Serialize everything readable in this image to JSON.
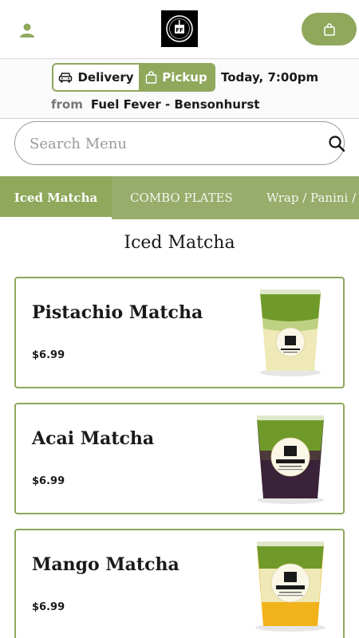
{
  "header": {
    "user_icon": "user-icon",
    "logo_text": "FF",
    "cart_icon": "shopping-bag-icon"
  },
  "order": {
    "delivery_label": "Delivery",
    "pickup_label": "Pickup",
    "selected": "Pickup",
    "time": "Today, 7:00pm",
    "from_label": "from",
    "location": "Fuel Fever - Bensonhurst"
  },
  "search": {
    "placeholder": "Search Menu"
  },
  "tabs": [
    {
      "label": "Iced Matcha",
      "active": true
    },
    {
      "label": "COMBO PLATES",
      "active": false
    },
    {
      "label": "Wrap / Panini /",
      "active": false
    }
  ],
  "section": {
    "title": "Iced Matcha"
  },
  "items": [
    {
      "name": "Pistachio Matcha",
      "price": "$6.99",
      "image": "pistachio-matcha-cup"
    },
    {
      "name": "Acai Matcha",
      "price": "$6.99",
      "image": "acai-matcha-cup"
    },
    {
      "name": "Mango Matcha",
      "price": "$6.99",
      "image": "mango-matcha-cup"
    }
  ],
  "colors": {
    "accent": "#8fa85c",
    "tab_bar": "#98ac6b",
    "matcha_green": "#6f9a2a",
    "pistachio_cream": "#efe9b8",
    "acai_purple": "#3a2238",
    "mango_yellow": "#f2b21a"
  }
}
